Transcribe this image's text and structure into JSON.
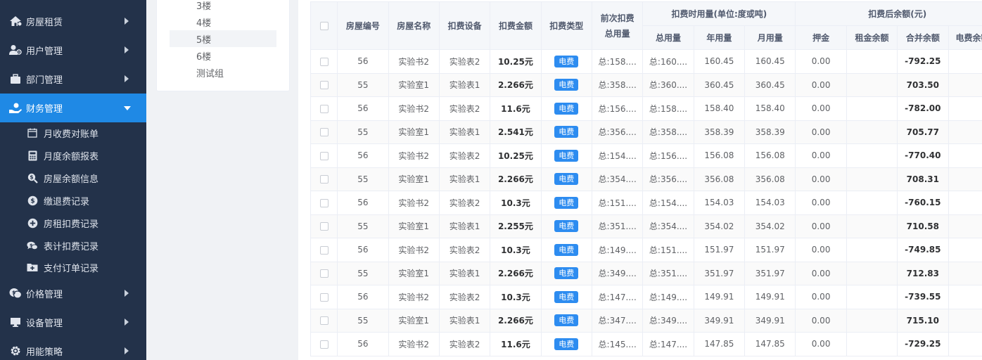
{
  "sidebar": {
    "items": [
      {
        "label": "房屋租赁",
        "icon": "house-icon"
      },
      {
        "label": "用户管理",
        "icon": "users-icon"
      },
      {
        "label": "部门管理",
        "icon": "briefcase-icon"
      },
      {
        "label": "财务管理",
        "icon": "hand-money-icon"
      },
      {
        "label": "价格管理",
        "icon": "coins-icon"
      },
      {
        "label": "设备管理",
        "icon": "monitor-icon"
      },
      {
        "label": "用能策略",
        "icon": "gear-icon"
      }
    ],
    "sub_items": [
      {
        "label": "月收费对账单",
        "icon": "calendar-icon"
      },
      {
        "label": "月度余额报表",
        "icon": "calculator-icon"
      },
      {
        "label": "房屋余额信息",
        "icon": "search-dollar-icon"
      },
      {
        "label": "缴退费记录",
        "icon": "dollar-circle-icon"
      },
      {
        "label": "房租扣费记录",
        "icon": "plus-circle-icon"
      },
      {
        "label": "表计扣费记录",
        "icon": "comments-dollar-icon"
      },
      {
        "label": "支付订单记录",
        "icon": "folder-plus-icon"
      }
    ]
  },
  "tree": {
    "nodes": [
      "3楼",
      "4楼",
      "5楼",
      "6楼",
      "测试组"
    ]
  },
  "table": {
    "headers": {
      "room_no": "房屋编号",
      "room_name": "房屋名称",
      "device": "扣费设备",
      "amount": "扣费金额",
      "type": "扣费类型",
      "prev_total_line1": "前次扣费",
      "prev_total_line2": "总用量",
      "usage_group": "扣费时用量(单位:度或吨)",
      "total": "总用量",
      "year": "年用量",
      "month": "月用量",
      "balance_group": "扣费后余额(元)",
      "deposit": "押金",
      "rent_balance": "租金余额",
      "merged_balance": "合并余额",
      "elec_balance": "电费余额"
    },
    "rows": [
      {
        "room_no": "56",
        "room_name": "实验书2",
        "device": "实验表2",
        "amount": "10.25元",
        "type": "电费",
        "prev": "总:158....",
        "total": "总:160....",
        "year": "160.45",
        "month": "160.45",
        "deposit": "0.00",
        "rent": "",
        "merged": "-792.25"
      },
      {
        "room_no": "55",
        "room_name": "实验室1",
        "device": "实验表1",
        "amount": "2.266元",
        "type": "电费",
        "prev": "总:358....",
        "total": "总:360....",
        "year": "360.45",
        "month": "360.45",
        "deposit": "0.00",
        "rent": "",
        "merged": "703.50"
      },
      {
        "room_no": "56",
        "room_name": "实验书2",
        "device": "实验表2",
        "amount": "11.6元",
        "type": "电费",
        "prev": "总:156....",
        "total": "总:158....",
        "year": "158.40",
        "month": "158.40",
        "deposit": "0.00",
        "rent": "",
        "merged": "-782.00"
      },
      {
        "room_no": "55",
        "room_name": "实验室1",
        "device": "实验表1",
        "amount": "2.541元",
        "type": "电费",
        "prev": "总:356....",
        "total": "总:358....",
        "year": "358.39",
        "month": "358.39",
        "deposit": "0.00",
        "rent": "",
        "merged": "705.77"
      },
      {
        "room_no": "56",
        "room_name": "实验书2",
        "device": "实验表2",
        "amount": "10.25元",
        "type": "电费",
        "prev": "总:154....",
        "total": "总:156....",
        "year": "156.08",
        "month": "156.08",
        "deposit": "0.00",
        "rent": "",
        "merged": "-770.40"
      },
      {
        "room_no": "55",
        "room_name": "实验室1",
        "device": "实验表1",
        "amount": "2.266元",
        "type": "电费",
        "prev": "总:354....",
        "total": "总:356....",
        "year": "356.08",
        "month": "356.08",
        "deposit": "0.00",
        "rent": "",
        "merged": "708.31"
      },
      {
        "room_no": "56",
        "room_name": "实验书2",
        "device": "实验表2",
        "amount": "10.3元",
        "type": "电费",
        "prev": "总:151....",
        "total": "总:154....",
        "year": "154.03",
        "month": "154.03",
        "deposit": "0.00",
        "rent": "",
        "merged": "-760.15"
      },
      {
        "room_no": "55",
        "room_name": "实验室1",
        "device": "实验表1",
        "amount": "2.255元",
        "type": "电费",
        "prev": "总:351....",
        "total": "总:354....",
        "year": "354.02",
        "month": "354.02",
        "deposit": "0.00",
        "rent": "",
        "merged": "710.58"
      },
      {
        "room_no": "56",
        "room_name": "实验书2",
        "device": "实验表2",
        "amount": "10.3元",
        "type": "电费",
        "prev": "总:149....",
        "total": "总:151....",
        "year": "151.97",
        "month": "151.97",
        "deposit": "0.00",
        "rent": "",
        "merged": "-749.85"
      },
      {
        "room_no": "55",
        "room_name": "实验室1",
        "device": "实验表1",
        "amount": "2.266元",
        "type": "电费",
        "prev": "总:349....",
        "total": "总:351....",
        "year": "351.97",
        "month": "351.97",
        "deposit": "0.00",
        "rent": "",
        "merged": "712.83"
      },
      {
        "room_no": "56",
        "room_name": "实验书2",
        "device": "实验表2",
        "amount": "10.3元",
        "type": "电费",
        "prev": "总:147....",
        "total": "总:149....",
        "year": "149.91",
        "month": "149.91",
        "deposit": "0.00",
        "rent": "",
        "merged": "-739.55"
      },
      {
        "room_no": "55",
        "room_name": "实验室1",
        "device": "实验表1",
        "amount": "2.266元",
        "type": "电费",
        "prev": "总:347....",
        "total": "总:349....",
        "year": "349.91",
        "month": "349.91",
        "deposit": "0.00",
        "rent": "",
        "merged": "715.10"
      },
      {
        "room_no": "56",
        "room_name": "实验书2",
        "device": "实验表2",
        "amount": "11.6元",
        "type": "电费",
        "prev": "总:145....",
        "total": "总:147....",
        "year": "147.85",
        "month": "147.85",
        "deposit": "0.00",
        "rent": "",
        "merged": "-729.25"
      }
    ]
  },
  "colors": {
    "sidebar_bg": "#23324a",
    "active_bg": "#1f89e5",
    "tag_bg": "#2d8cf0"
  }
}
